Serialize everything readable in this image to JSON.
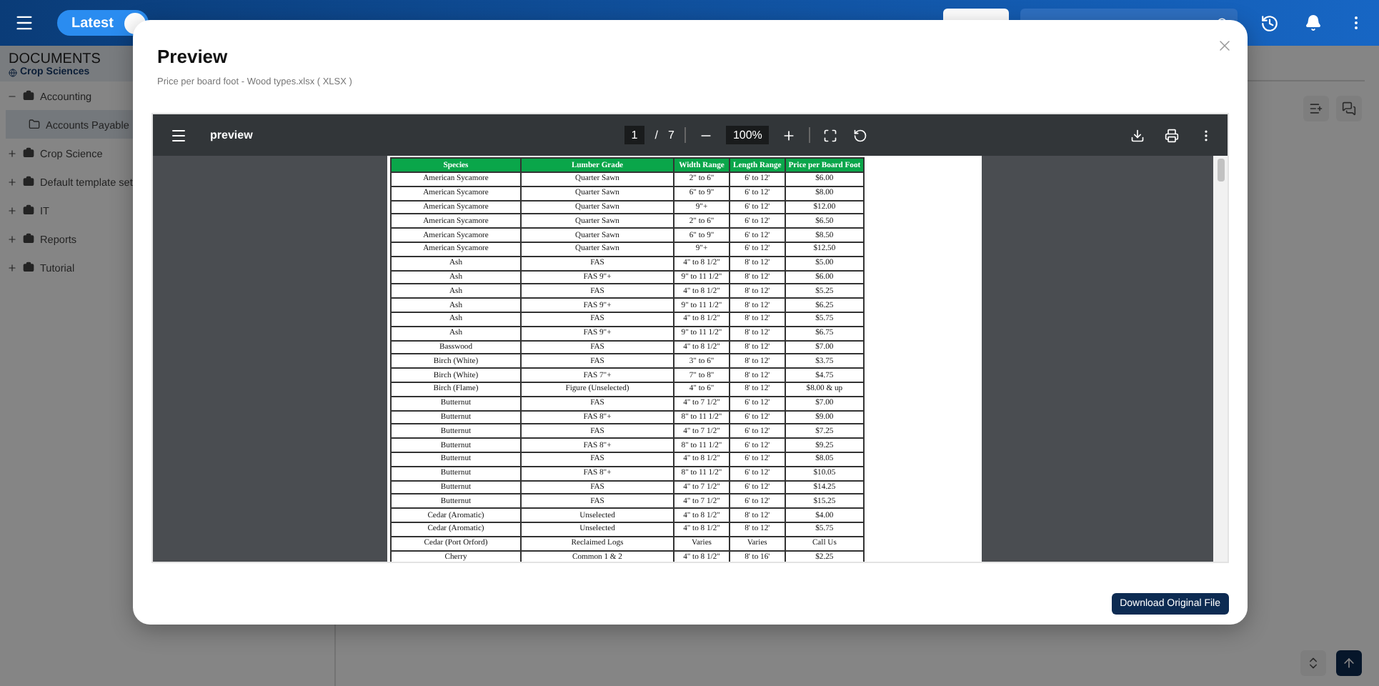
{
  "header": {
    "toggle": {
      "label": "Latest",
      "on": true
    }
  },
  "sidebar": {
    "title": "DOCUMENTS",
    "workspace": "Crop Sciences",
    "items": [
      {
        "label": "Accounting",
        "expanded": true,
        "children": [
          {
            "label": "Accounts Payable",
            "selected": true
          }
        ]
      },
      {
        "label": "Crop Science",
        "expanded": false
      },
      {
        "label": "Default template set",
        "expanded": false
      },
      {
        "label": "IT",
        "expanded": false
      },
      {
        "label": "Reports",
        "expanded": false
      },
      {
        "label": "Tutorial",
        "expanded": false
      }
    ]
  },
  "dialog": {
    "title": "Preview",
    "subtitle": "Price per board foot - Wood types.xlsx ( XLSX )",
    "viewer": {
      "document": "preview",
      "page": "1",
      "page_separator": "/",
      "pages": "7",
      "zoom": "100%",
      "table": {
        "columns": [
          "Species",
          "Lumber Grade",
          "Width Range",
          "Length Range",
          "Price per Board Foot"
        ],
        "rows": [
          [
            "American Sycamore",
            "Quarter Sawn",
            "2\" to 6\"",
            "6' to 12'",
            "$6.00"
          ],
          [
            "American Sycamore",
            "Quarter Sawn",
            "6\" to 9\"",
            "6' to 12'",
            "$8.00"
          ],
          [
            "American Sycamore",
            "Quarter Sawn",
            "9\"+",
            "6' to 12'",
            "$12.00"
          ],
          [
            "American Sycamore",
            "Quarter Sawn",
            "2\" to 6\"",
            "6' to 12'",
            "$6.50"
          ],
          [
            "American Sycamore",
            "Quarter Sawn",
            "6\" to 9\"",
            "6' to 12'",
            "$8.50"
          ],
          [
            "American Sycamore",
            "Quarter Sawn",
            "9\"+",
            "6' to 12'",
            "$12.50"
          ],
          [
            "Ash",
            "FAS",
            "4\" to 8 1/2\"",
            "8' to 12'",
            "$5.00"
          ],
          [
            "Ash",
            "FAS 9\"+",
            "9\" to 11 1/2\"",
            "8' to 12'",
            "$6.00"
          ],
          [
            "Ash",
            "FAS",
            "4\" to 8 1/2\"",
            "8' to 12'",
            "$5.25"
          ],
          [
            "Ash",
            "FAS 9\"+",
            "9\" to 11 1/2\"",
            "8' to 12'",
            "$6.25"
          ],
          [
            "Ash",
            "FAS",
            "4\" to 8 1/2\"",
            "8' to 12'",
            "$5.75"
          ],
          [
            "Ash",
            "FAS 9\"+",
            "9\" to 11 1/2\"",
            "8' to 12'",
            "$6.75"
          ],
          [
            "Basswood",
            "FAS",
            "4\" to 8 1/2\"",
            "8' to 12'",
            "$7.00"
          ],
          [
            "Birch (White)",
            "FAS",
            "3\" to 6\"",
            "8' to 12'",
            "$3.75"
          ],
          [
            "Birch (White)",
            "FAS 7\"+",
            "7\" to 8\"",
            "8' to 12'",
            "$4.75"
          ],
          [
            "Birch (Flame)",
            "Figure (Unselected)",
            "4\" to 6\"",
            "8' to 12'",
            "$8.00 & up"
          ],
          [
            "Butternut",
            "FAS",
            "4\" to 7 1/2\"",
            "6' to 12'",
            "$7.00"
          ],
          [
            "Butternut",
            "FAS 8\"+",
            "8\" to 11 1/2\"",
            "6' to 12'",
            "$9.00"
          ],
          [
            "Butternut",
            "FAS",
            "4\" to 7 1/2\"",
            "6' to 12'",
            "$7.25"
          ],
          [
            "Butternut",
            "FAS 8\"+",
            "8\" to 11 1/2\"",
            "6' to 12'",
            "$9.25"
          ],
          [
            "Butternut",
            "FAS",
            "4\" to 8 1/2\"",
            "6' to 12'",
            "$8.05"
          ],
          [
            "Butternut",
            "FAS 8\"+",
            "8\" to 11 1/2\"",
            "6' to 12'",
            "$10.05"
          ],
          [
            "Butternut",
            "FAS",
            "4\" to 7 1/2\"",
            "6' to 12'",
            "$14.25"
          ],
          [
            "Butternut",
            "FAS",
            "4\" to 7 1/2\"",
            "6' to 12'",
            "$15.25"
          ],
          [
            "Cedar (Aromatic)",
            "Unselected",
            "4\" to 8 1/2\"",
            "8' to 12'",
            "$4.00"
          ],
          [
            "Cedar (Aromatic)",
            "Unselected",
            "4\" to 8 1/2\"",
            "8' to 12'",
            "$5.75"
          ],
          [
            "Cedar (Port Orford)",
            "Reclaimed Logs",
            "Varies",
            "Varies",
            "Call Us"
          ],
          [
            "Cherry",
            "Common 1 & 2",
            "4\" to 8 1/2\"",
            "8' to 16'",
            "$2.25"
          ]
        ]
      }
    },
    "download_button": "Download Original File"
  }
}
